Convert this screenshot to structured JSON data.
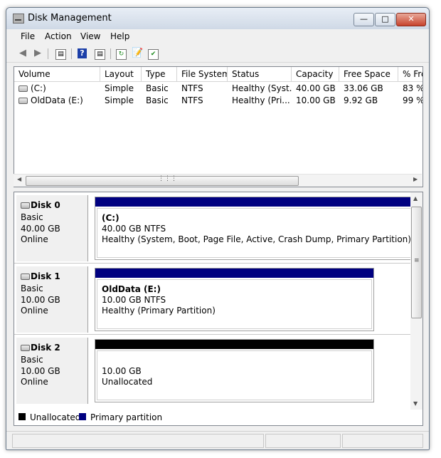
{
  "window": {
    "title": "Disk Management"
  },
  "menu": [
    "File",
    "Action",
    "View",
    "Help"
  ],
  "toolbar_icons": [
    "back-arrow-icon",
    "forward-arrow-icon",
    "show-hide-tree-icon",
    "help-icon",
    "properties-pane-icon",
    "refresh-icon",
    "properties-icon",
    "disk-settings-icon"
  ],
  "volume_list": {
    "columns": [
      "Volume",
      "Layout",
      "Type",
      "File System",
      "Status",
      "Capacity",
      "Free Space",
      "% Fre"
    ],
    "rows": [
      {
        "volume": "(C:)",
        "layout": "Simple",
        "type": "Basic",
        "fs": "NTFS",
        "status": "Healthy (Syst...",
        "capacity": "40.00 GB",
        "free": "33.06 GB",
        "pct": "83 %"
      },
      {
        "volume": "OldData (E:)",
        "layout": "Simple",
        "type": "Basic",
        "fs": "NTFS",
        "status": "Healthy (Pri...",
        "capacity": "10.00 GB",
        "free": "9.92 GB",
        "pct": "99 %"
      }
    ]
  },
  "disks": [
    {
      "name": "Disk 0",
      "type": "Basic",
      "size": "40.00 GB",
      "status": "Online",
      "partition": {
        "title": "(C:)",
        "size": "40.00 GB NTFS",
        "status": "Healthy (System, Boot, Page File, Active, Crash Dump, Primary Partition)",
        "kind": "primary"
      }
    },
    {
      "name": "Disk 1",
      "type": "Basic",
      "size": "10.00 GB",
      "status": "Online",
      "partition": {
        "title": "OldData  (E:)",
        "size": "10.00 GB NTFS",
        "status": "Healthy (Primary Partition)",
        "kind": "primary"
      }
    },
    {
      "name": "Disk 2",
      "type": "Basic",
      "size": "10.00 GB",
      "status": "Online",
      "partition": {
        "title": "",
        "size": "10.00 GB",
        "status": "Unallocated",
        "kind": "unallocated"
      }
    }
  ],
  "legend": [
    {
      "label": "Unallocated",
      "color": "#000000"
    },
    {
      "label": "Primary partition",
      "color": "#000080"
    }
  ],
  "colors": {
    "primary": "#000080",
    "unallocated": "#000000"
  }
}
